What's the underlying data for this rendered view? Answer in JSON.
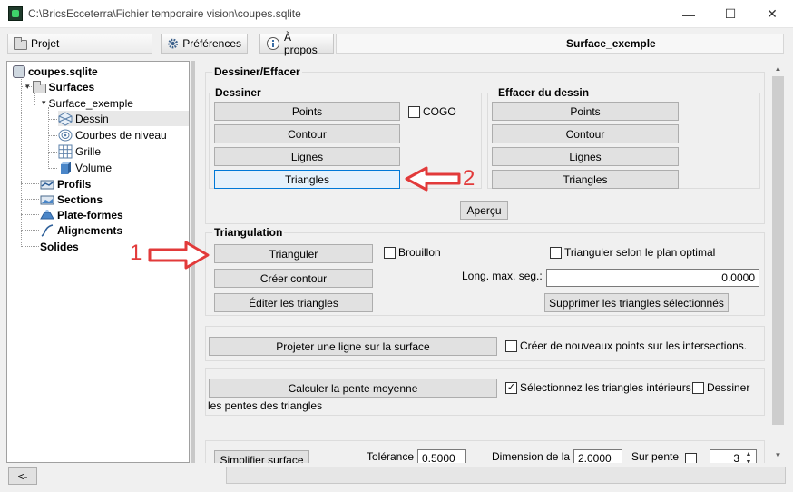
{
  "window": {
    "title": "C:\\BricsEcceterra\\Fichier temporaire vision\\coupes.sqlite",
    "minimize": "—",
    "maximize": "☐",
    "close": "✕"
  },
  "toolbar": {
    "projet_label": "Projet",
    "preferences_label": "Préférences",
    "apropos_label": "À propos",
    "surface_title": "Surface_exemple"
  },
  "tree": {
    "root": "coupes.sqlite",
    "surfaces": "Surfaces",
    "surface_exemple": "Surface_exemple",
    "dessin": "Dessin",
    "courbes": "Courbes de niveau",
    "grille": "Grille",
    "volume": "Volume",
    "profils": "Profils",
    "sections": "Sections",
    "plateformes": "Plate-formes",
    "alignements": "Alignements",
    "solides": "Solides"
  },
  "dessiner_effacer": {
    "title": "Dessiner/Effacer",
    "dessiner_title": "Dessiner",
    "effacer_title": "Effacer du dessin",
    "points": "Points",
    "contour": "Contour",
    "lignes": "Lignes",
    "triangles": "Triangles",
    "cogo": "COGO",
    "apercu": "Aperçu"
  },
  "triangulation": {
    "title": "Triangulation",
    "trianguler": "Trianguler",
    "creer_contour": "Créer contour",
    "editer": "Éditer les triangles",
    "brouillon": "Brouillon",
    "plan_optimal": "Trianguler selon le plan optimal",
    "long_max_label": "Long. max. seg.:",
    "long_max_value": "0.0000",
    "supprimer": "Supprimer les triangles sélectionnés"
  },
  "projeter": {
    "button": "Projeter une ligne sur la surface",
    "checkbox": "Créer de nouveaux points sur les intersections."
  },
  "pente": {
    "button": "Calculer la pente moyenne",
    "check_interieurs": "Sélectionnez les triangles intérieurs",
    "check_interieurs_mark": "✓",
    "dessiner": "Dessiner",
    "dessiner_wrap": "les pentes des triangles"
  },
  "simplifier": {
    "button": "Simplifier surface",
    "tolerance_label": "Tolérance",
    "tolerance_value": "0.5000",
    "dimension_label": "Dimension de la",
    "dimension_value": "2.0000",
    "sur_pente_label": "Sur pente",
    "spin_value": "3"
  },
  "annotations": {
    "one": "1",
    "two": "2"
  },
  "bottom": {
    "back": "<-"
  },
  "colors": {
    "callout": "#e23a3a",
    "highlight_border": "#0078d7"
  }
}
